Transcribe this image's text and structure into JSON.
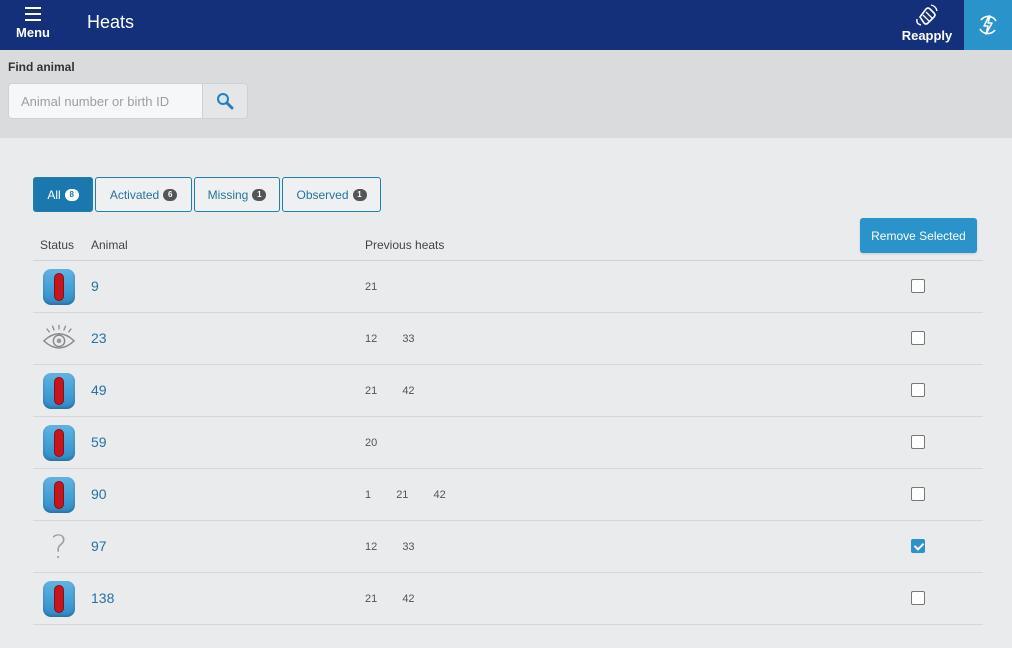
{
  "header": {
    "menu_label": "Menu",
    "title": "Heats",
    "reapply_label": "Reapply",
    "menu_icon": "hamburger-icon",
    "reapply_icon": "reapply-hand-icon",
    "sync_icon": "sync-bolt-icon",
    "bar_color": "#14307a",
    "accent_color": "#2a93c9"
  },
  "search": {
    "label": "Find animal",
    "placeholder": "Animal number or birth ID",
    "value": "",
    "icon": "search-icon"
  },
  "filters": [
    {
      "label": "All",
      "count": "8",
      "active": true
    },
    {
      "label": "Activated",
      "count": "6",
      "active": false
    },
    {
      "label": "Missing",
      "count": "1",
      "active": false
    },
    {
      "label": "Observed",
      "count": "1",
      "active": false
    }
  ],
  "actions": {
    "remove_selected_label": "Remove Selected"
  },
  "table": {
    "columns": [
      "Status",
      "Animal",
      "Previous heats"
    ],
    "rows": [
      {
        "status": "activated-tag-icon",
        "animal": "9",
        "previous_heats": [
          "21"
        ],
        "selected": false
      },
      {
        "status": "observed-eye-icon",
        "animal": "23",
        "previous_heats": [
          "12",
          "33"
        ],
        "selected": false
      },
      {
        "status": "activated-tag-icon",
        "animal": "49",
        "previous_heats": [
          "21",
          "42"
        ],
        "selected": false
      },
      {
        "status": "activated-tag-icon",
        "animal": "59",
        "previous_heats": [
          "20"
        ],
        "selected": false
      },
      {
        "status": "activated-tag-icon",
        "animal": "90",
        "previous_heats": [
          "1",
          "21",
          "42"
        ],
        "selected": false
      },
      {
        "status": "missing-question-icon",
        "animal": "97",
        "previous_heats": [
          "12",
          "33"
        ],
        "selected": true
      },
      {
        "status": "activated-tag-icon",
        "animal": "138",
        "previous_heats": [
          "21",
          "42"
        ],
        "selected": false
      }
    ]
  }
}
